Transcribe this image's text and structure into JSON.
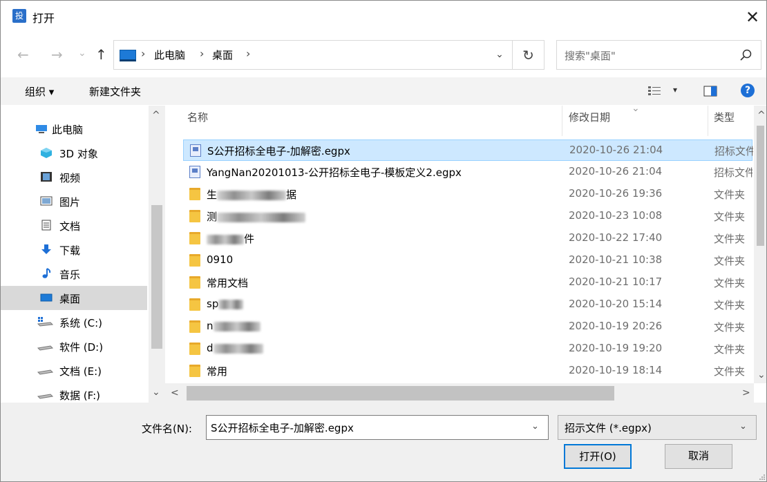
{
  "window": {
    "title": "打开",
    "app_icon_text": "投",
    "close_glyph": "✕"
  },
  "nav": {
    "back_glyph": "←",
    "forward_glyph": "→",
    "recent_glyph": "⌄",
    "up_glyph": "↑",
    "breadcrumb": [
      "此电脑",
      "桌面"
    ],
    "crumb_sep": "›",
    "dropdown_glyph": "⌄",
    "refresh_glyph": "↻"
  },
  "search": {
    "placeholder": "搜索\"桌面\""
  },
  "toolbar": {
    "organize_label": "组织 ▾",
    "new_folder_label": "新建文件夹",
    "view_menu_glyph": "▾",
    "help_glyph": "?"
  },
  "sidebar": {
    "scroll_up_glyph": "^",
    "scroll_down_glyph": "⌄",
    "items": [
      {
        "label": "此电脑",
        "icon": "computer-icon"
      },
      {
        "label": "3D 对象",
        "icon": "3d-objects-icon"
      },
      {
        "label": "视频",
        "icon": "video-icon"
      },
      {
        "label": "图片",
        "icon": "pictures-icon"
      },
      {
        "label": "文档",
        "icon": "documents-icon"
      },
      {
        "label": "下载",
        "icon": "download-icon"
      },
      {
        "label": "音乐",
        "icon": "music-icon"
      },
      {
        "label": "桌面",
        "icon": "desktop-icon",
        "selected": true
      },
      {
        "label": "系统 (C:)",
        "icon": "system-drive-icon"
      },
      {
        "label": "软件 (D:)",
        "icon": "drive-icon"
      },
      {
        "label": "文档 (E:)",
        "icon": "drive-icon"
      },
      {
        "label": "数据 (F:)",
        "icon": "drive-icon"
      }
    ]
  },
  "file_list": {
    "columns": {
      "name": "名称",
      "date": "修改日期",
      "type": "类型",
      "sort_glyph": "⌄"
    },
    "scroll_up_glyph": "^",
    "scroll_down_glyph": "⌄",
    "scroll_left_glyph": "<",
    "scroll_right_glyph": ">",
    "rows": [
      {
        "name": "S公开招标全电子-加解密.egpx",
        "date": "2020-10-26 21:04",
        "type": "招标文件",
        "icon": "egpx-file-icon",
        "selected": true
      },
      {
        "name": "YangNan20201013-公开招标全电子-模板定义2.egpx",
        "date": "2020-10-26 21:04",
        "type": "招标文件",
        "icon": "egpx-file-icon"
      },
      {
        "name_prefix": "生",
        "name_suffix": "据",
        "date": "2020-10-26 19:36",
        "type": "文件夹",
        "icon": "folder-icon",
        "obscured": true
      },
      {
        "name_prefix": "测",
        "name_suffix": "",
        "date": "2020-10-23 10:08",
        "type": "文件夹",
        "icon": "folder-icon",
        "obscured": true
      },
      {
        "name_prefix": "",
        "name_suffix": "件",
        "date": "2020-10-22 17:40",
        "type": "文件夹",
        "icon": "folder-icon",
        "obscured": true
      },
      {
        "name": "0910",
        "date": "2020-10-21 10:38",
        "type": "文件夹",
        "icon": "folder-icon"
      },
      {
        "name": "常用文档",
        "date": "2020-10-21 10:17",
        "type": "文件夹",
        "icon": "folder-icon"
      },
      {
        "name_prefix": "sp",
        "name_suffix": "",
        "date": "2020-10-20 15:14",
        "type": "文件夹",
        "icon": "folder-icon",
        "obscured": true
      },
      {
        "name_prefix": "n",
        "name_suffix": "",
        "date": "2020-10-19 20:26",
        "type": "文件夹",
        "icon": "folder-icon",
        "obscured": true
      },
      {
        "name_prefix": "d",
        "name_suffix": "",
        "date": "2020-10-19 19:20",
        "type": "文件夹",
        "icon": "folder-icon",
        "obscured": true
      },
      {
        "name": "常用",
        "date": "2020-10-19 18:14",
        "type": "文件夹",
        "icon": "folder-icon"
      }
    ]
  },
  "footer": {
    "filename_label": "文件名(N):",
    "filename_value": "S公开招标全电子-加解密.egpx",
    "filetype_value": "招示文件 (*.egpx)",
    "dropdown_glyph": "⌄",
    "open_label": "打开(O)",
    "cancel_label": "取消"
  },
  "colors": {
    "accent": "#0078d7",
    "selection": "#cde8ff",
    "folder": "#f5c542"
  }
}
